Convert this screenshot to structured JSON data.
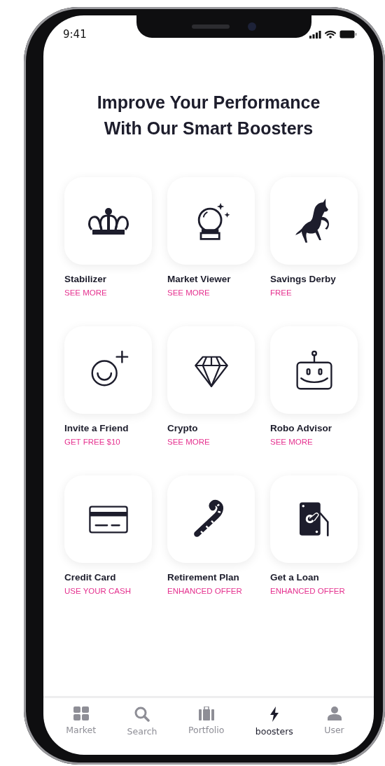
{
  "status_bar": {
    "time": "9:41"
  },
  "title": "Improve Your Performance With Our Smart Boosters",
  "boosters": [
    {
      "name": "Stabilizer",
      "action": "SEE MORE"
    },
    {
      "name": "Market Viewer",
      "action": "SEE MORE"
    },
    {
      "name": "Savings Derby",
      "action": "FREE"
    },
    {
      "name": "Invite a Friend",
      "action": "GET FREE $10"
    },
    {
      "name": "Crypto",
      "action": "SEE MORE"
    },
    {
      "name": "Robo Advisor",
      "action": "SEE MORE"
    },
    {
      "name": "Credit Card",
      "action": "USE YOUR CASH"
    },
    {
      "name": "Retirement Plan",
      "action": "ENHANCED OFFER"
    },
    {
      "name": "Get a Loan",
      "action": "ENHANCED OFFER"
    }
  ],
  "tab_bar": [
    {
      "label": "Market",
      "selected": false
    },
    {
      "label": "Search",
      "selected": false
    },
    {
      "label": "Portfolio",
      "selected": false
    },
    {
      "label": "boosters",
      "selected": true
    },
    {
      "label": "User",
      "selected": false
    }
  ]
}
